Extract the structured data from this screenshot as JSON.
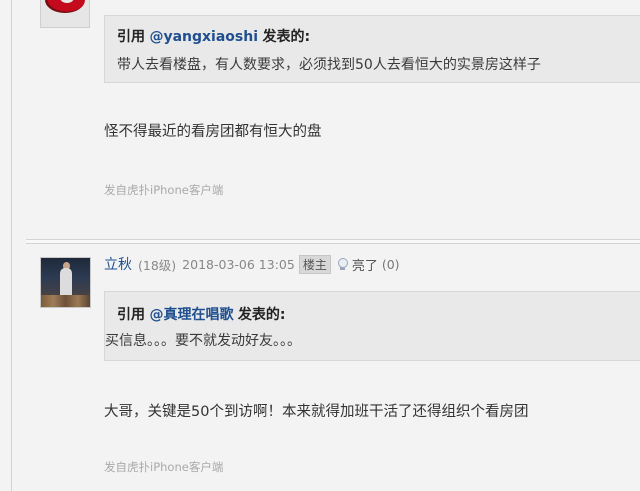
{
  "post1": {
    "quote": {
      "prefix": "引用",
      "user": "@yangxiaoshi",
      "suffix": "发表的:",
      "body": "带人去看楼盘，有人数要求，必须找到50人去看恒大的实景房这样子"
    },
    "reply": "怪不得最近的看房团都有恒大的盘",
    "source": "发自虎扑iPhone客户端"
  },
  "post2": {
    "author": "立秋",
    "level": "(18级)",
    "time": "2018-03-06 13:05",
    "badge": "楼主",
    "light_label": "亮了",
    "light_count": "(0)",
    "quote": {
      "prefix": "引用",
      "user": "@真理在唱歌",
      "suffix": "发表的:",
      "body": "买信息。。。要不就发动好友。。。"
    },
    "reply": "大哥，关键是50个到访啊！本来就得加班干活了还得组织个看房团",
    "source": "发自虎扑iPhone客户端"
  },
  "colors": {
    "background": "#f3f3f3",
    "quote_bg": "#e9e9e9",
    "link": "#1f4f8e",
    "muted": "#a9a9a9"
  },
  "icons": [
    "user-avatar",
    "light-bulb-icon"
  ]
}
